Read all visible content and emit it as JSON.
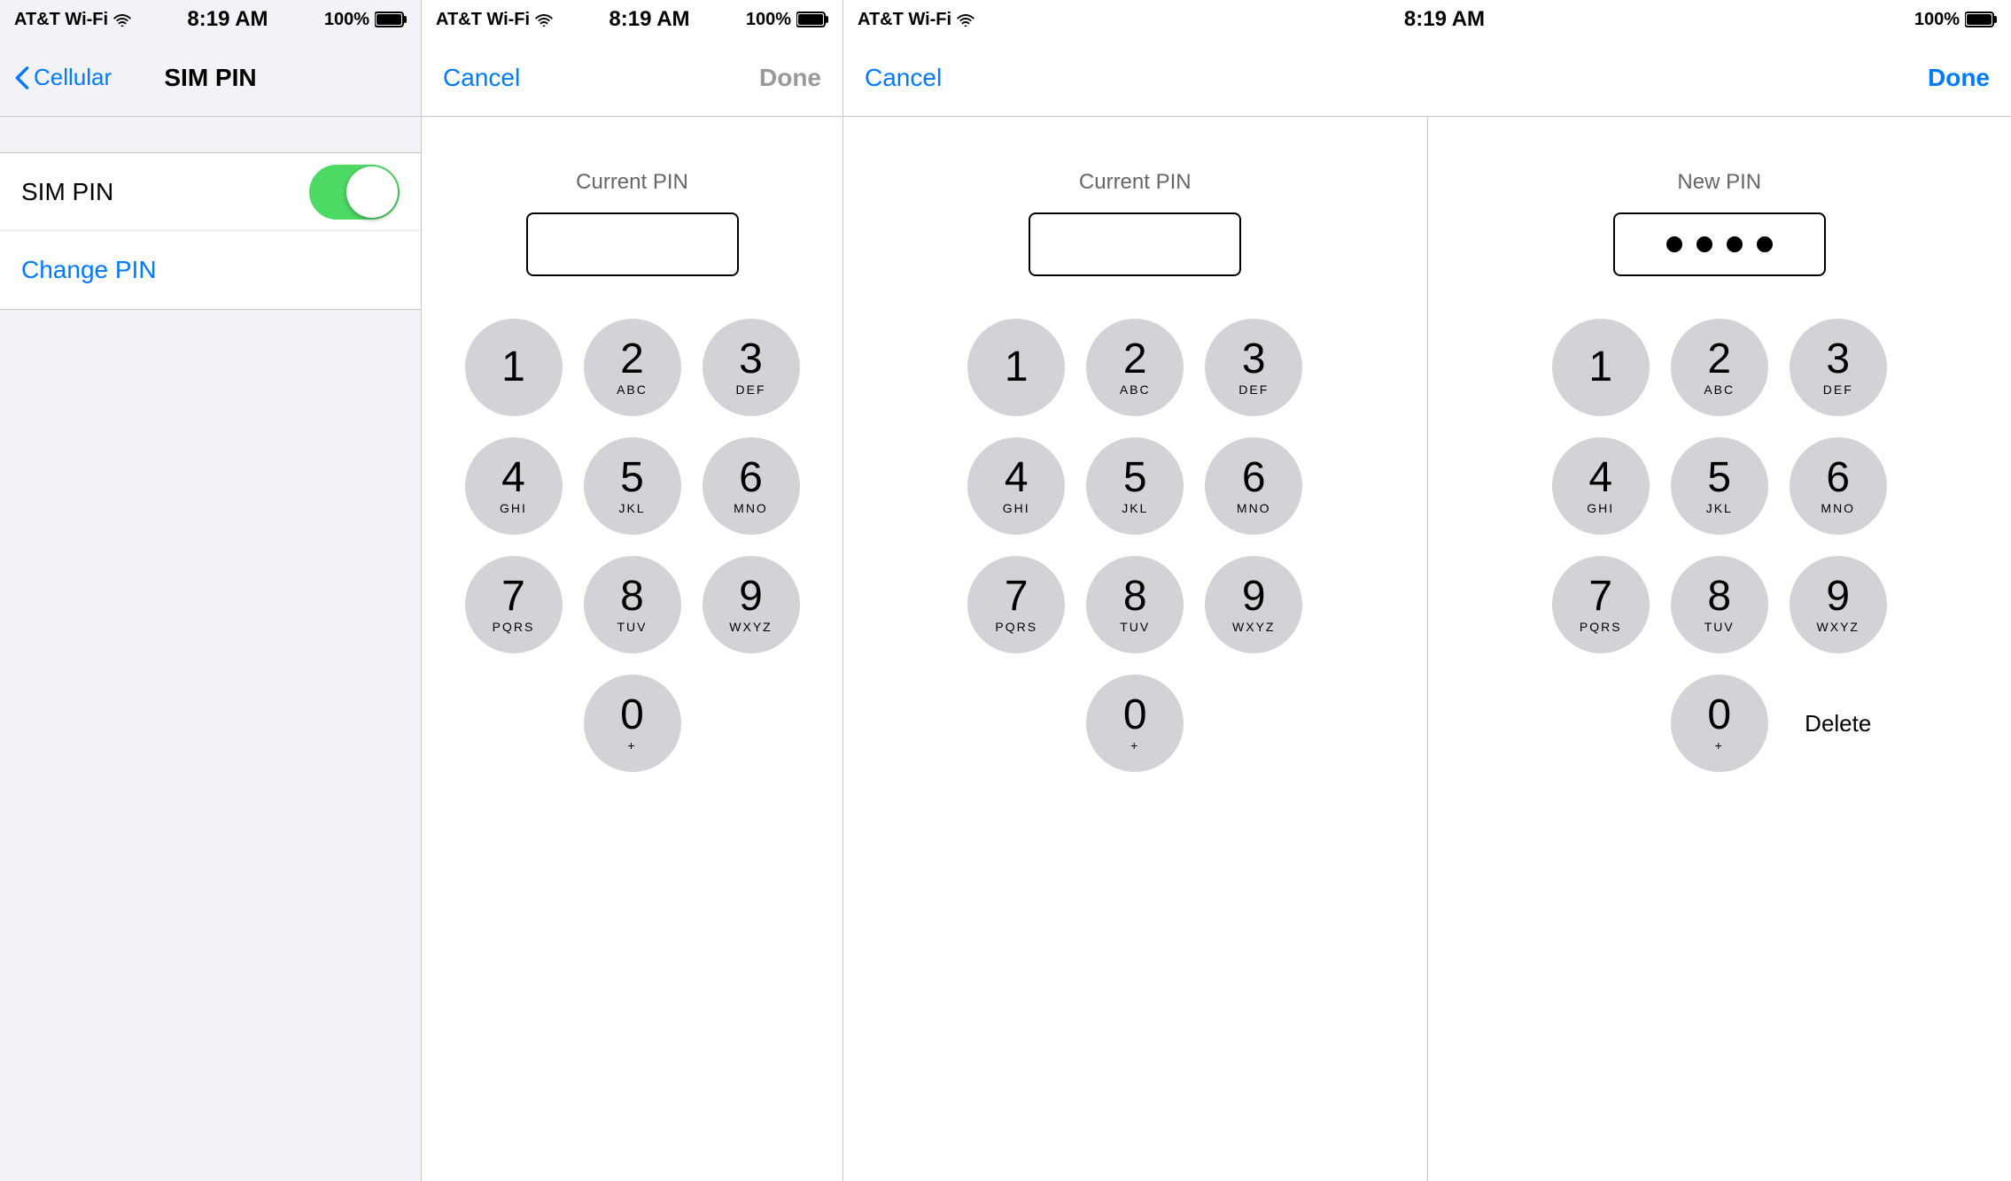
{
  "panel1": {
    "statusBar": {
      "carrier": "AT&T Wi-Fi",
      "wifi": true,
      "time": "8:19 AM",
      "battery": "100%"
    },
    "navBack": "Cellular",
    "navTitle": "SIM PIN",
    "simPin": {
      "label": "SIM PIN",
      "toggleOn": true
    },
    "changePin": "Change PIN"
  },
  "panel2": {
    "statusBar": {
      "carrier": "AT&T Wi-Fi",
      "time": "8:19 AM",
      "battery": "100%"
    },
    "cancel": "Cancel",
    "done": "Done",
    "doneActive": false,
    "pinLabel": "Current PIN",
    "pinValue": "",
    "keypad": {
      "keys": [
        {
          "num": "1",
          "letters": ""
        },
        {
          "num": "2",
          "letters": "ABC"
        },
        {
          "num": "3",
          "letters": "DEF"
        },
        {
          "num": "4",
          "letters": "GHI"
        },
        {
          "num": "5",
          "letters": "JKL"
        },
        {
          "num": "6",
          "letters": "MNO"
        },
        {
          "num": "7",
          "letters": "PQRS"
        },
        {
          "num": "8",
          "letters": "TUV"
        },
        {
          "num": "9",
          "letters": "WXYZ"
        },
        {
          "num": "0",
          "letters": "+"
        }
      ]
    }
  },
  "panel3": {
    "statusBar": {
      "carrier": "AT&T Wi-Fi",
      "time": "8:19 AM",
      "battery": "100%"
    },
    "cancel": "Cancel",
    "done": "Done",
    "doneActive": true,
    "currentPinLabel": "Current PIN",
    "newPinLabel": "New PIN",
    "currentPinValue": "",
    "newPinDots": 4,
    "keypad": {
      "keys": [
        {
          "num": "1",
          "letters": ""
        },
        {
          "num": "2",
          "letters": "ABC"
        },
        {
          "num": "3",
          "letters": "DEF"
        },
        {
          "num": "4",
          "letters": "GHI"
        },
        {
          "num": "5",
          "letters": "JKL"
        },
        {
          "num": "6",
          "letters": "MNO"
        },
        {
          "num": "7",
          "letters": "PQRS"
        },
        {
          "num": "8",
          "letters": "TUV"
        },
        {
          "num": "9",
          "letters": "WXYZ"
        },
        {
          "num": "0",
          "letters": "+"
        }
      ],
      "deleteLabel": "Delete"
    }
  },
  "icons": {
    "chevronLeft": "‹",
    "wifi": "▲",
    "battery": "▮"
  }
}
